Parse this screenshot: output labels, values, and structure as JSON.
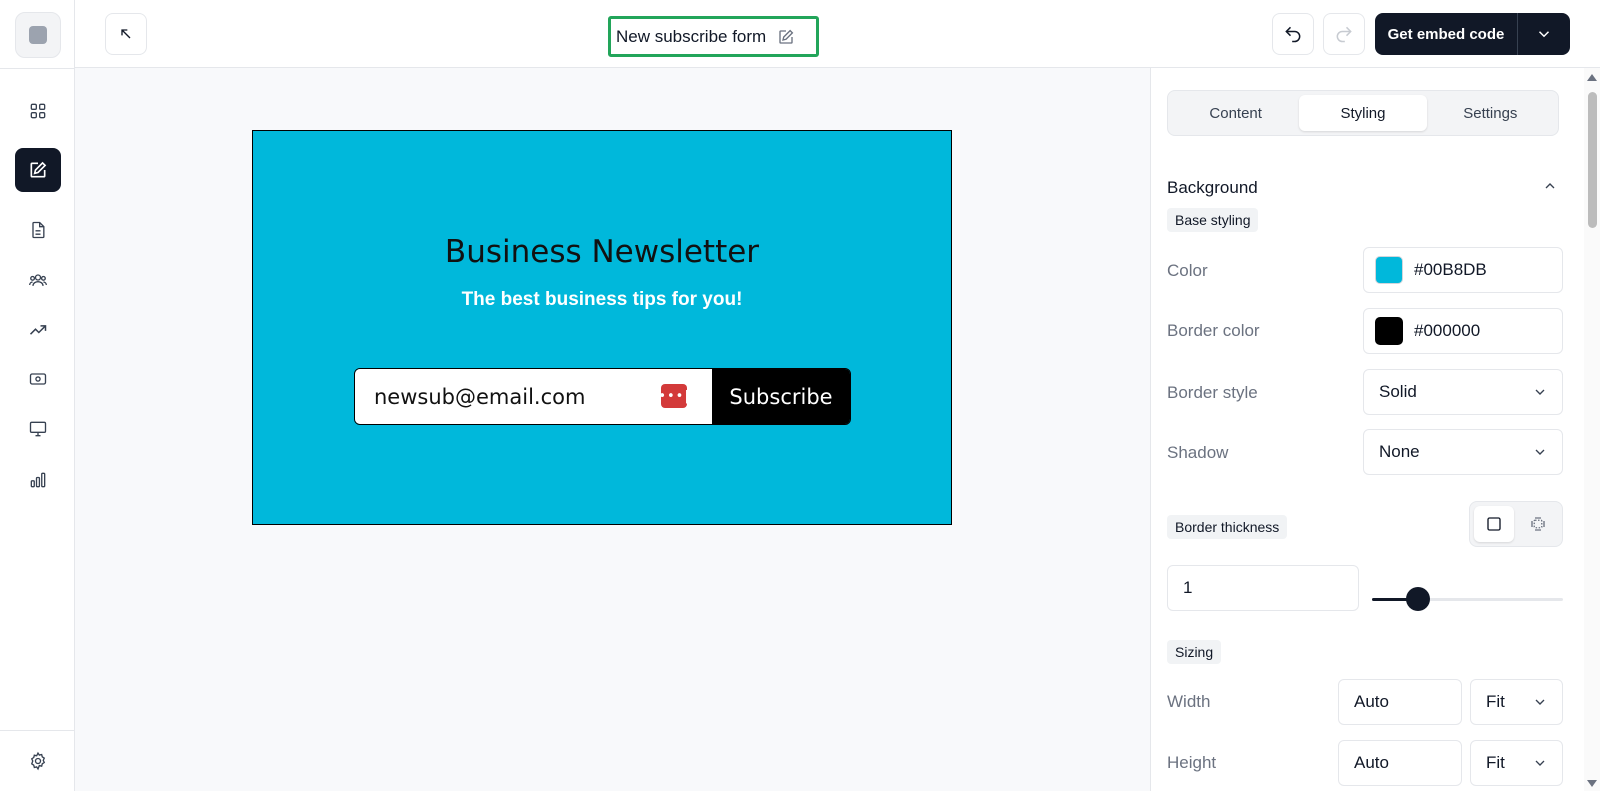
{
  "header": {
    "form_title": "New subscribe form",
    "embed_label": "Get embed code"
  },
  "preview": {
    "title": "Business Newsletter",
    "subtitle": "The best business tips for you!",
    "email_value": "newsub@email.com",
    "password_badge": "•••|",
    "subscribe_label": "Subscribe",
    "background_color": "#00B8DB"
  },
  "panel": {
    "tabs": [
      {
        "label": "Content"
      },
      {
        "label": "Styling"
      },
      {
        "label": "Settings"
      }
    ],
    "active_tab": "Styling",
    "background": {
      "title": "Background",
      "base_chip": "Base styling",
      "color_label": "Color",
      "color_value": "#00B8DB",
      "border_color_label": "Border color",
      "border_color_value": "#000000",
      "border_style_label": "Border style",
      "border_style_value": "Solid",
      "shadow_label": "Shadow",
      "shadow_value": "None",
      "border_thickness_chip": "Border thickness",
      "border_thickness_value": "1",
      "border_thickness_fill": 0.24
    },
    "sizing": {
      "chip": "Sizing",
      "width_label": "Width",
      "width_value": "Auto",
      "width_mode": "Fit",
      "height_label": "Height",
      "height_value": "Auto",
      "height_mode": "Fit"
    }
  },
  "icons": {
    "rail": [
      "grid-icon",
      "edit-icon",
      "document-icon",
      "users-icon",
      "trending-up-icon",
      "money-icon",
      "monitor-icon",
      "bar-chart-icon"
    ],
    "settings": "settings-gear-icon"
  },
  "colors": {
    "accent": "#111827",
    "title_highlight": "#22a55a",
    "form_bg": "#00B8DB",
    "border": "#000000"
  }
}
